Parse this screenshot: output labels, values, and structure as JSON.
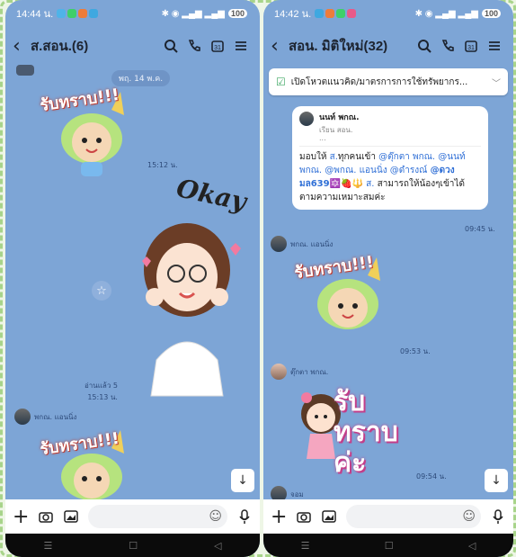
{
  "left": {
    "status": {
      "time": "14:44 น.",
      "battery": "100"
    },
    "header": {
      "title": "ส.สอน.(6)"
    },
    "date_chip": "พฤ. 14 พ.ค.",
    "sticker1_text": "รับทราบ!!!",
    "sticker1_time": "15:12 น.",
    "okay_text": "Okay",
    "read_label": "อ่านแล้ว 5",
    "okay_time": "15:13 น.",
    "sender2": "พกณ. แอนนิ่ง",
    "sticker2_text": "รับทราบ!!!"
  },
  "right": {
    "status": {
      "time": "14:42 น.",
      "battery": "100"
    },
    "header": {
      "title": "สอน. มิติใหม่(32)"
    },
    "notice": "เปิดโหวตแนวคิด/มาตรการการใช้ทรัพยากร...",
    "reply": {
      "name": "นนท์ พกณ.",
      "snippet": "เรียน สอน.",
      "dots": "..."
    },
    "message": {
      "p1": "มอบให้ ",
      "m1": "ส.",
      "p2": "ทุกคนเข้า ",
      "m2": "@ตุ๊กตา พกณ.",
      "m3": "@นนท์ พกณ.",
      "m4": "@พกณ. แอนนิ่ง",
      "m5": "@ดำรงณ์",
      "m6": "@ดวงมล639",
      "m7": "ส.",
      "p3": "สามารถให้น้องๆเข้าได้ตามความเหมาะสมค่ะ"
    },
    "message_time": "09:45 น.",
    "sender1": "พกณ. แอนนิ่ง",
    "sticker1_text": "รับทราบ!!!",
    "sticker1_time": "09:53 น.",
    "sender2": "ตุ๊กตา พกณ.",
    "sticker2_text": "รับทราบค่ะ",
    "sticker2_time": "09:54 น.",
    "sender3": "จอม"
  },
  "colors": {
    "chat_bg": "#7da5d6",
    "mention": "#2f6fd6"
  },
  "icons": [
    "back-arrow-icon",
    "search-icon",
    "phone-icon",
    "calendar-icon",
    "menu-icon",
    "plus-icon",
    "camera-icon",
    "image-icon",
    "emoji-icon",
    "mic-icon",
    "scroll-down-icon",
    "star-icon"
  ]
}
